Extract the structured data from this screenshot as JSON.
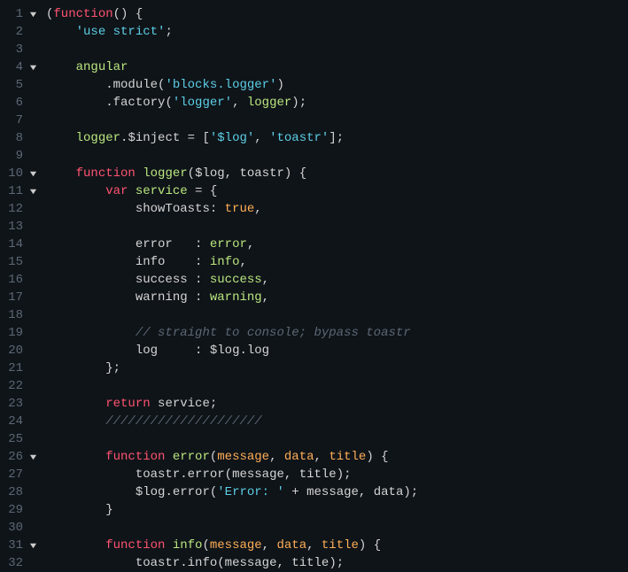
{
  "lines": [
    {
      "n": 1,
      "fold": true,
      "tokens": [
        {
          "t": "(",
          "c": "punct"
        },
        {
          "t": "function",
          "c": "keyword"
        },
        {
          "t": "() {",
          "c": "punct"
        }
      ]
    },
    {
      "n": 2,
      "fold": false,
      "tokens": [
        {
          "t": "    ",
          "c": "default"
        },
        {
          "t": "'use strict'",
          "c": "string"
        },
        {
          "t": ";",
          "c": "punct"
        }
      ]
    },
    {
      "n": 3,
      "fold": false,
      "tokens": []
    },
    {
      "n": 4,
      "fold": true,
      "tokens": [
        {
          "t": "    ",
          "c": "default"
        },
        {
          "t": "angular",
          "c": "ident-g"
        }
      ]
    },
    {
      "n": 5,
      "fold": false,
      "tokens": [
        {
          "t": "        .",
          "c": "punct"
        },
        {
          "t": "module",
          "c": "default"
        },
        {
          "t": "(",
          "c": "punct"
        },
        {
          "t": "'blocks.logger'",
          "c": "string"
        },
        {
          "t": ")",
          "c": "punct"
        }
      ]
    },
    {
      "n": 6,
      "fold": false,
      "tokens": [
        {
          "t": "        .",
          "c": "punct"
        },
        {
          "t": "factory",
          "c": "default"
        },
        {
          "t": "(",
          "c": "punct"
        },
        {
          "t": "'logger'",
          "c": "string"
        },
        {
          "t": ", ",
          "c": "punct"
        },
        {
          "t": "logger",
          "c": "ident-g"
        },
        {
          "t": ");",
          "c": "punct"
        }
      ]
    },
    {
      "n": 7,
      "fold": false,
      "tokens": []
    },
    {
      "n": 8,
      "fold": false,
      "tokens": [
        {
          "t": "    ",
          "c": "default"
        },
        {
          "t": "logger",
          "c": "ident-g"
        },
        {
          "t": ".",
          "c": "punct"
        },
        {
          "t": "$inject",
          "c": "default"
        },
        {
          "t": " = [",
          "c": "punct"
        },
        {
          "t": "'$log'",
          "c": "string"
        },
        {
          "t": ", ",
          "c": "punct"
        },
        {
          "t": "'toastr'",
          "c": "string"
        },
        {
          "t": "];",
          "c": "punct"
        }
      ]
    },
    {
      "n": 9,
      "fold": false,
      "tokens": []
    },
    {
      "n": 10,
      "fold": true,
      "tokens": [
        {
          "t": "    ",
          "c": "default"
        },
        {
          "t": "function",
          "c": "keyword"
        },
        {
          "t": " ",
          "c": "default"
        },
        {
          "t": "logger",
          "c": "ident-g"
        },
        {
          "t": "(",
          "c": "punct"
        },
        {
          "t": "$log",
          "c": "default"
        },
        {
          "t": ", ",
          "c": "punct"
        },
        {
          "t": "toastr",
          "c": "default"
        },
        {
          "t": ") {",
          "c": "punct"
        }
      ]
    },
    {
      "n": 11,
      "fold": true,
      "tokens": [
        {
          "t": "        ",
          "c": "default"
        },
        {
          "t": "var",
          "c": "keyword"
        },
        {
          "t": " ",
          "c": "default"
        },
        {
          "t": "service",
          "c": "ident-g"
        },
        {
          "t": " = {",
          "c": "punct"
        }
      ]
    },
    {
      "n": 12,
      "fold": false,
      "tokens": [
        {
          "t": "            ",
          "c": "default"
        },
        {
          "t": "showToasts",
          "c": "default"
        },
        {
          "t": ": ",
          "c": "punct"
        },
        {
          "t": "true",
          "c": "bool"
        },
        {
          "t": ",",
          "c": "punct"
        }
      ]
    },
    {
      "n": 13,
      "fold": false,
      "tokens": []
    },
    {
      "n": 14,
      "fold": false,
      "tokens": [
        {
          "t": "            ",
          "c": "default"
        },
        {
          "t": "error",
          "c": "default"
        },
        {
          "t": "   : ",
          "c": "punct"
        },
        {
          "t": "error",
          "c": "ident-g"
        },
        {
          "t": ",",
          "c": "punct"
        }
      ]
    },
    {
      "n": 15,
      "fold": false,
      "tokens": [
        {
          "t": "            ",
          "c": "default"
        },
        {
          "t": "info",
          "c": "default"
        },
        {
          "t": "    : ",
          "c": "punct"
        },
        {
          "t": "info",
          "c": "ident-g"
        },
        {
          "t": ",",
          "c": "punct"
        }
      ]
    },
    {
      "n": 16,
      "fold": false,
      "tokens": [
        {
          "t": "            ",
          "c": "default"
        },
        {
          "t": "success",
          "c": "default"
        },
        {
          "t": " : ",
          "c": "punct"
        },
        {
          "t": "success",
          "c": "ident-g"
        },
        {
          "t": ",",
          "c": "punct"
        }
      ]
    },
    {
      "n": 17,
      "fold": false,
      "tokens": [
        {
          "t": "            ",
          "c": "default"
        },
        {
          "t": "warning",
          "c": "default"
        },
        {
          "t": " : ",
          "c": "punct"
        },
        {
          "t": "warning",
          "c": "ident-g"
        },
        {
          "t": ",",
          "c": "punct"
        }
      ]
    },
    {
      "n": 18,
      "fold": false,
      "tokens": []
    },
    {
      "n": 19,
      "fold": false,
      "tokens": [
        {
          "t": "            ",
          "c": "default"
        },
        {
          "t": "// straight to console; bypass toastr",
          "c": "comment"
        }
      ]
    },
    {
      "n": 20,
      "fold": false,
      "tokens": [
        {
          "t": "            ",
          "c": "default"
        },
        {
          "t": "log",
          "c": "default"
        },
        {
          "t": "     : ",
          "c": "punct"
        },
        {
          "t": "$log",
          "c": "default"
        },
        {
          "t": ".",
          "c": "punct"
        },
        {
          "t": "log",
          "c": "default"
        }
      ]
    },
    {
      "n": 21,
      "fold": false,
      "tokens": [
        {
          "t": "        };",
          "c": "punct"
        }
      ]
    },
    {
      "n": 22,
      "fold": false,
      "tokens": []
    },
    {
      "n": 23,
      "fold": false,
      "tokens": [
        {
          "t": "        ",
          "c": "default"
        },
        {
          "t": "return",
          "c": "keyword"
        },
        {
          "t": " ",
          "c": "default"
        },
        {
          "t": "service",
          "c": "default"
        },
        {
          "t": ";",
          "c": "punct"
        }
      ]
    },
    {
      "n": 24,
      "fold": false,
      "tokens": [
        {
          "t": "        ",
          "c": "default"
        },
        {
          "t": "/////////////////////",
          "c": "comment"
        }
      ]
    },
    {
      "n": 25,
      "fold": false,
      "tokens": []
    },
    {
      "n": 26,
      "fold": true,
      "tokens": [
        {
          "t": "        ",
          "c": "default"
        },
        {
          "t": "function",
          "c": "keyword"
        },
        {
          "t": " ",
          "c": "default"
        },
        {
          "t": "error",
          "c": "ident-g"
        },
        {
          "t": "(",
          "c": "punct"
        },
        {
          "t": "message",
          "c": "param"
        },
        {
          "t": ", ",
          "c": "punct"
        },
        {
          "t": "data",
          "c": "param"
        },
        {
          "t": ", ",
          "c": "punct"
        },
        {
          "t": "title",
          "c": "param"
        },
        {
          "t": ") {",
          "c": "punct"
        }
      ]
    },
    {
      "n": 27,
      "fold": false,
      "tokens": [
        {
          "t": "            ",
          "c": "default"
        },
        {
          "t": "toastr",
          "c": "default"
        },
        {
          "t": ".",
          "c": "punct"
        },
        {
          "t": "error",
          "c": "default"
        },
        {
          "t": "(",
          "c": "punct"
        },
        {
          "t": "message",
          "c": "default"
        },
        {
          "t": ", ",
          "c": "punct"
        },
        {
          "t": "title",
          "c": "default"
        },
        {
          "t": ");",
          "c": "punct"
        }
      ]
    },
    {
      "n": 28,
      "fold": false,
      "tokens": [
        {
          "t": "            ",
          "c": "default"
        },
        {
          "t": "$log",
          "c": "default"
        },
        {
          "t": ".",
          "c": "punct"
        },
        {
          "t": "error",
          "c": "default"
        },
        {
          "t": "(",
          "c": "punct"
        },
        {
          "t": "'Error: '",
          "c": "string"
        },
        {
          "t": " + ",
          "c": "punct"
        },
        {
          "t": "message",
          "c": "default"
        },
        {
          "t": ", ",
          "c": "punct"
        },
        {
          "t": "data",
          "c": "default"
        },
        {
          "t": ");",
          "c": "punct"
        }
      ]
    },
    {
      "n": 29,
      "fold": false,
      "tokens": [
        {
          "t": "        }",
          "c": "punct"
        }
      ]
    },
    {
      "n": 30,
      "fold": false,
      "tokens": []
    },
    {
      "n": 31,
      "fold": true,
      "tokens": [
        {
          "t": "        ",
          "c": "default"
        },
        {
          "t": "function",
          "c": "keyword"
        },
        {
          "t": " ",
          "c": "default"
        },
        {
          "t": "info",
          "c": "ident-g"
        },
        {
          "t": "(",
          "c": "punct"
        },
        {
          "t": "message",
          "c": "param"
        },
        {
          "t": ", ",
          "c": "punct"
        },
        {
          "t": "data",
          "c": "param"
        },
        {
          "t": ", ",
          "c": "punct"
        },
        {
          "t": "title",
          "c": "param"
        },
        {
          "t": ") {",
          "c": "punct"
        }
      ]
    },
    {
      "n": 32,
      "fold": false,
      "tokens": [
        {
          "t": "            ",
          "c": "default"
        },
        {
          "t": "toastr",
          "c": "default"
        },
        {
          "t": ".",
          "c": "punct"
        },
        {
          "t": "info",
          "c": "default"
        },
        {
          "t": "(",
          "c": "punct"
        },
        {
          "t": "message",
          "c": "default"
        },
        {
          "t": ", ",
          "c": "punct"
        },
        {
          "t": "title",
          "c": "default"
        },
        {
          "t": ");",
          "c": "punct"
        }
      ]
    }
  ]
}
